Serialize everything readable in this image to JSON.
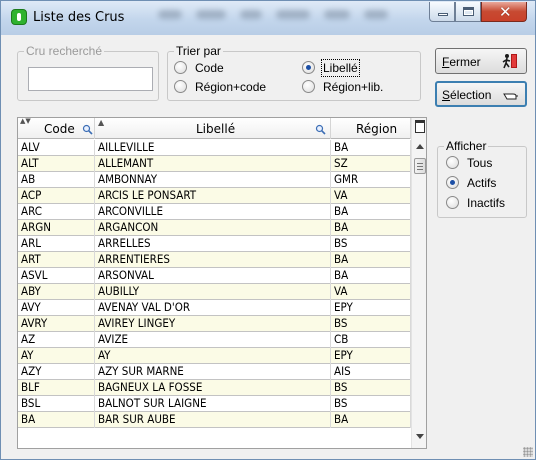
{
  "window": {
    "title": "Liste des Crus",
    "controls": {
      "minimize_icon": "minimize-icon",
      "maximize_icon": "maximize-icon",
      "close_icon": "close-icon",
      "close_glyph": "✕"
    }
  },
  "search": {
    "legend": "Cru recherché",
    "value": ""
  },
  "sort": {
    "legend": "Trier par",
    "options": [
      {
        "label": "Code",
        "selected": false
      },
      {
        "label": "Libellé",
        "selected": true
      },
      {
        "label": "Région+code",
        "selected": false
      },
      {
        "label": "Région+lib.",
        "selected": false
      }
    ]
  },
  "buttons": {
    "close": {
      "label_first": "F",
      "label_rest": "ermer",
      "icon": "exit-door-icon"
    },
    "select": {
      "label_first": "S",
      "label_rest": "élection",
      "icon": "select-hand-icon"
    }
  },
  "table": {
    "columns": [
      "Code",
      "Libellé",
      "Région"
    ],
    "rows": [
      [
        "ALV",
        "AILLEVILLE",
        "BA"
      ],
      [
        "ALT",
        "ALLEMANT",
        "SZ"
      ],
      [
        "AB",
        "AMBONNAY",
        "GMR"
      ],
      [
        "ACP",
        "ARCIS LE PONSART",
        "VA"
      ],
      [
        "ARC",
        "ARCONVILLE",
        "BA"
      ],
      [
        "ARGN",
        "ARGANCON",
        "BA"
      ],
      [
        "ARL",
        "ARRELLES",
        "BS"
      ],
      [
        "ART",
        "ARRENTIERES",
        "BA"
      ],
      [
        "ASVL",
        "ARSONVAL",
        "BA"
      ],
      [
        "ABY",
        "AUBILLY",
        "VA"
      ],
      [
        "AVY",
        "AVENAY VAL D'OR",
        "EPY"
      ],
      [
        "AVRY",
        "AVIREY LINGEY",
        "BS"
      ],
      [
        "AZ",
        "AVIZE",
        "CB"
      ],
      [
        "AY",
        "AY",
        "EPY"
      ],
      [
        "AZY",
        "AZY SUR MARNE",
        "AIS"
      ],
      [
        "BLF",
        "BAGNEUX LA FOSSE",
        "BS"
      ],
      [
        "BSL",
        "BALNOT SUR LAIGNE",
        "BS"
      ],
      [
        "BA",
        "BAR SUR AUBE",
        "BA"
      ]
    ]
  },
  "filter": {
    "legend": "Afficher",
    "options": [
      {
        "label": "Tous",
        "selected": false
      },
      {
        "label": "Actifs",
        "selected": true
      },
      {
        "label": "Inactifs",
        "selected": false
      }
    ]
  },
  "colors": {
    "title_gradient": "#c3d6ec",
    "row_alt": "#fbfbe6",
    "radio_dot": "#1c4fa5",
    "close_button": "#c74a32"
  }
}
